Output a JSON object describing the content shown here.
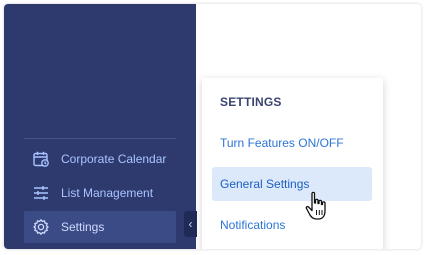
{
  "sidebar": {
    "items": [
      {
        "label": "Corporate Calendar",
        "icon": "calendar-icon"
      },
      {
        "label": "List Management",
        "icon": "sliders-icon"
      },
      {
        "label": "Settings",
        "icon": "gear-icon",
        "active": true
      }
    ],
    "collapse_glyph": "‹"
  },
  "settings_menu": {
    "header": "SETTINGS",
    "items": [
      {
        "label": "Turn Features ON/OFF"
      },
      {
        "label": "General Settings",
        "hovered": true
      },
      {
        "label": "Notifications"
      }
    ]
  },
  "colors": {
    "sidebar_bg": "#2e3a6e",
    "sidebar_text": "#a9c4ff",
    "active_item_bg": "#3b4b86",
    "menu_link": "#2d74d6",
    "menu_hover_bg": "#dbe9fb",
    "menu_header": "#3a4570"
  },
  "cursor": "hand-pointer-icon"
}
